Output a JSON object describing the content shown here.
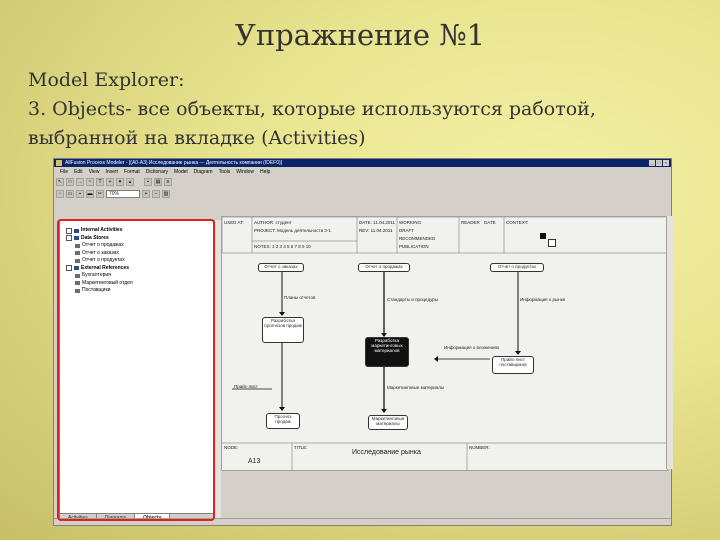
{
  "slide": {
    "title": "Упражнение №1",
    "line1": "Model Explorer:",
    "line2": "3. Objects- все объекты, которые используются работой,",
    "line3": "выбранной на вкладке (Activities)"
  },
  "window": {
    "title": "AllFusion Process Modeler - [(A0-A3) Исследование рынка — Деятельность компании (IDEF0)]",
    "menu": [
      "File",
      "Edit",
      "View",
      "Insert",
      "Format",
      "Dictionary",
      "Model",
      "Diagram",
      "Tools",
      "Window",
      "Help"
    ],
    "zoom_value": "70%"
  },
  "explorer": {
    "items": [
      {
        "label": "Internal Activities",
        "level": 0
      },
      {
        "label": "Data Stores",
        "level": 0
      },
      {
        "label": "Отчет о продажах",
        "level": 1
      },
      {
        "label": "Отчет о заказах",
        "level": 1
      },
      {
        "label": "Отчет о продуктах",
        "level": 1
      },
      {
        "label": "External References",
        "level": 0
      },
      {
        "label": "Бухгалтерия",
        "level": 1
      },
      {
        "label": "Маркетинговый отдел",
        "level": 1
      },
      {
        "label": "Поставщики",
        "level": 1
      }
    ],
    "tabs": [
      "Activities",
      "Diagrams",
      "Objects"
    ]
  },
  "diagram": {
    "header": {
      "used_at": "USED AT:",
      "author": "AUTHOR: студент",
      "project": "PROJECT: Модель деятельности 3-1",
      "notes": "NOTES: 1 2 3 4 5 6 7 8 9 10",
      "date": "DATE: 11.04.2011",
      "rev": "REV: 11.04.2011",
      "working": "WORKING",
      "draft": "DRAFT",
      "recommended": "RECOMMENDED",
      "publication": "PUBLICATION",
      "reader": "READER",
      "date2": "DATE",
      "context": "CONTEXT:"
    },
    "stores": [
      "Отчет о заказах",
      "Отчет о продажах",
      "Отчет о продуктах"
    ],
    "labels": {
      "plans": "Планы отчетов",
      "standards": "Стандарты и процедуры",
      "info_market": "Информация о рынке",
      "info_inv": "Информация о вложениях",
      "price_list": "Прайс-лист",
      "mk_materials": "Маркетинговые материалы"
    },
    "boxes": {
      "develop": "Разработка прогнозов продаж",
      "marketing": "Разработка маркетинговых материалов",
      "price": "Прайс-лист поставщиков",
      "forecast": "Прогноз продаж",
      "mk_out": "Маркетинговые материалы"
    },
    "footer": {
      "node": "NODE:",
      "node_value": "A13",
      "title_lbl": "TITLE:",
      "title_value": "Исследование рынка",
      "number": "NUMBER:"
    }
  }
}
